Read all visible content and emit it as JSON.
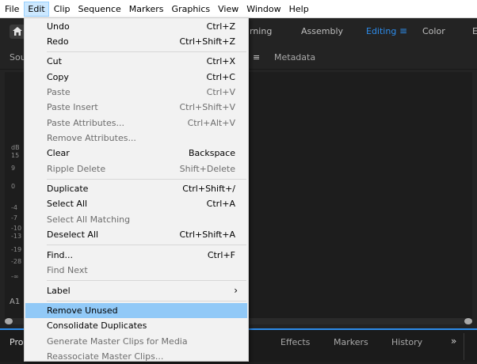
{
  "menubar": {
    "items": [
      "File",
      "Edit",
      "Clip",
      "Sequence",
      "Markers",
      "Graphics",
      "View",
      "Window",
      "Help"
    ]
  },
  "workspaces": {
    "items": [
      "rning",
      "Assembly",
      "Editing",
      "Color",
      "E"
    ],
    "active": "Editing",
    "menu_icon": "≡"
  },
  "panel": {
    "tabs": [
      "Sou",
      "Metadata"
    ],
    "meter": {
      "labels": [
        "dB",
        "15",
        "9",
        "0",
        "-4",
        "-7",
        "-10",
        "-13",
        "-19",
        "-28",
        "-∞"
      ],
      "track": "A1"
    }
  },
  "bottom_tabs": [
    "Pro",
    "Effects",
    "Markers",
    "History"
  ],
  "more_icon": "»",
  "edit_menu": {
    "items": [
      {
        "label": "Undo",
        "shortcut": "Ctrl+Z",
        "enabled": true
      },
      {
        "label": "Redo",
        "shortcut": "Ctrl+Shift+Z",
        "enabled": true
      },
      {
        "label": "Cut",
        "shortcut": "Ctrl+X",
        "enabled": true
      },
      {
        "label": "Copy",
        "shortcut": "Ctrl+C",
        "enabled": true
      },
      {
        "label": "Paste",
        "shortcut": "Ctrl+V",
        "enabled": false
      },
      {
        "label": "Paste Insert",
        "shortcut": "Ctrl+Shift+V",
        "enabled": false
      },
      {
        "label": "Paste Attributes...",
        "shortcut": "Ctrl+Alt+V",
        "enabled": false
      },
      {
        "label": "Remove Attributes...",
        "shortcut": "",
        "enabled": false
      },
      {
        "label": "Clear",
        "shortcut": "Backspace",
        "enabled": true
      },
      {
        "label": "Ripple Delete",
        "shortcut": "Shift+Delete",
        "enabled": false
      },
      {
        "label": "Duplicate",
        "shortcut": "Ctrl+Shift+/",
        "enabled": true
      },
      {
        "label": "Select All",
        "shortcut": "Ctrl+A",
        "enabled": true
      },
      {
        "label": "Select All Matching",
        "shortcut": "",
        "enabled": false
      },
      {
        "label": "Deselect All",
        "shortcut": "Ctrl+Shift+A",
        "enabled": true
      },
      {
        "label": "Find...",
        "shortcut": "Ctrl+F",
        "enabled": true
      },
      {
        "label": "Find Next",
        "shortcut": "",
        "enabled": false
      },
      {
        "label": "Label",
        "shortcut": "",
        "enabled": true,
        "submenu": true
      },
      {
        "label": "Remove Unused",
        "shortcut": "",
        "enabled": true,
        "highlighted": true
      },
      {
        "label": "Consolidate Duplicates",
        "shortcut": "",
        "enabled": true
      },
      {
        "label": "Generate Master Clips for Media",
        "shortcut": "",
        "enabled": false
      },
      {
        "label": "Reassociate Master Clips...",
        "shortcut": "",
        "enabled": false
      }
    ],
    "submenu_icon": "›"
  }
}
